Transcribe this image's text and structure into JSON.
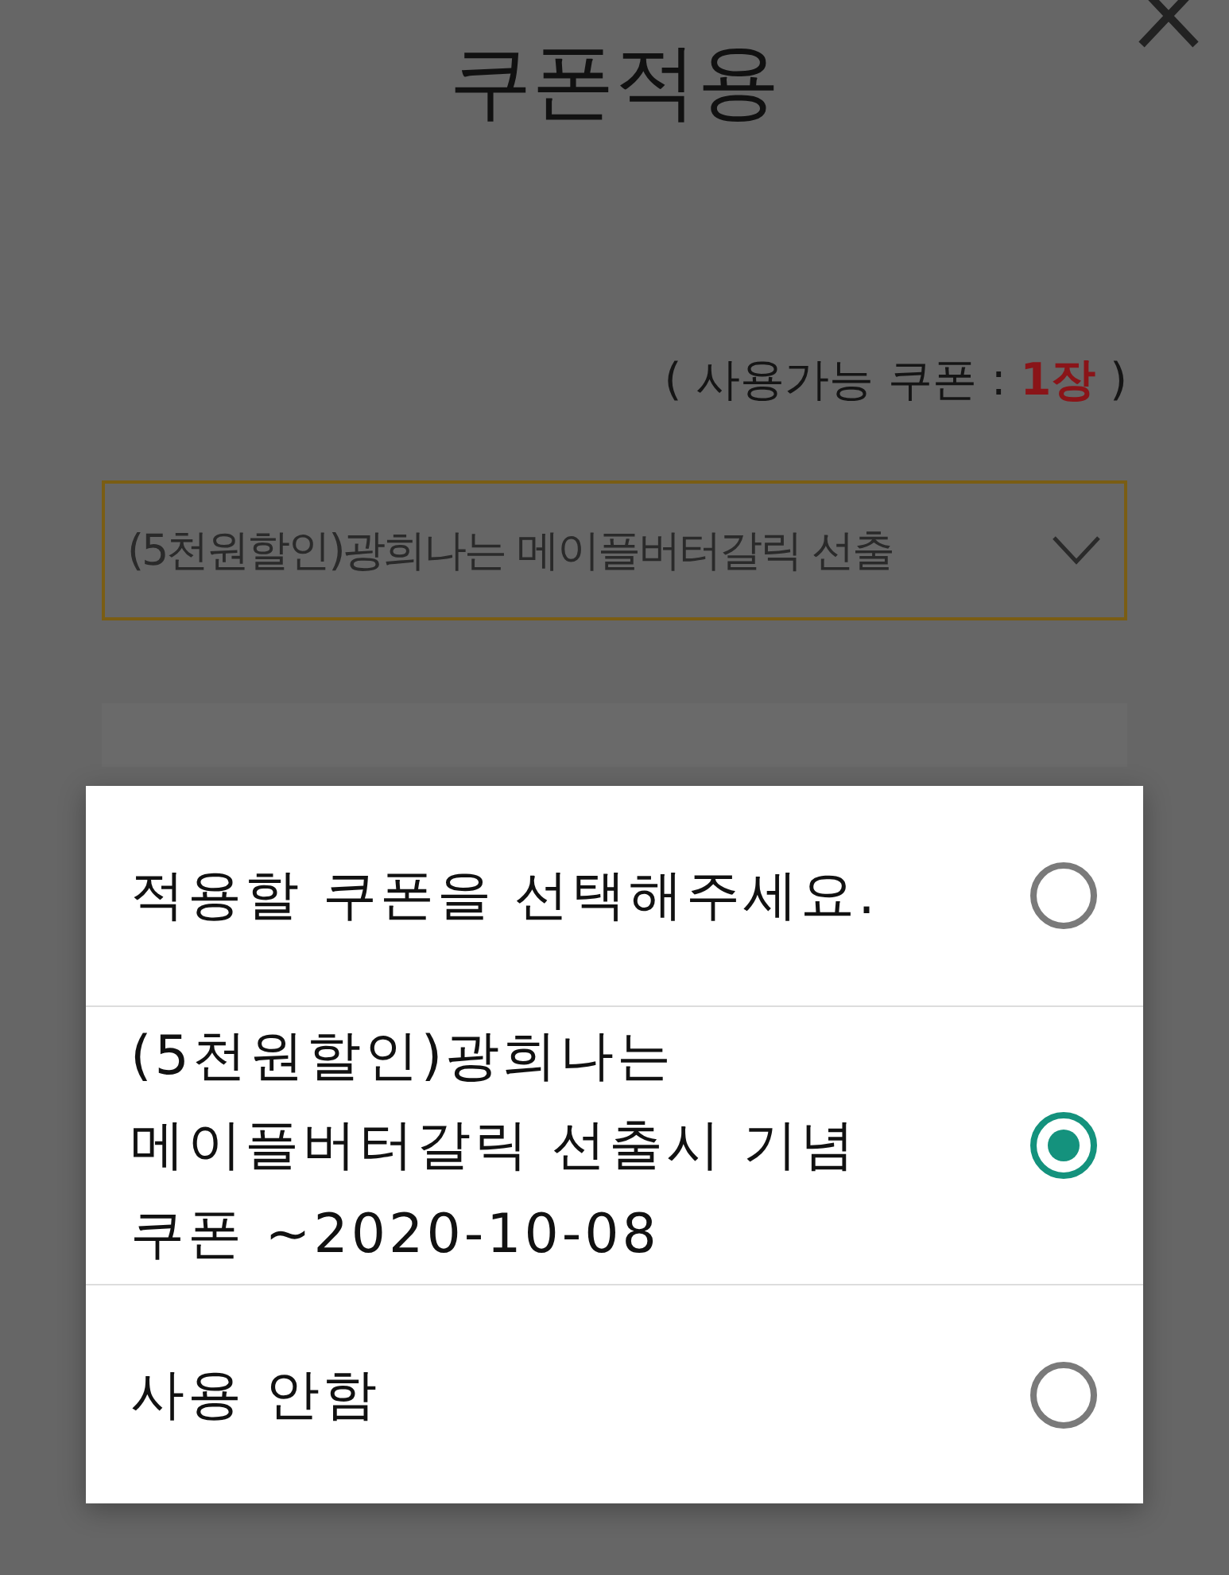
{
  "page": {
    "title": "쿠폰적용",
    "available": {
      "prefix": "( 사용가능 쿠폰 : ",
      "count": "1장",
      "suffix": " )"
    },
    "coupon_select": {
      "value": "(5천원할인)광희나는 메이플버터갈릭 선출"
    }
  },
  "dialog": {
    "options": [
      {
        "label": "적용할 쿠폰을 선택해주세요.",
        "selected": false
      },
      {
        "label": "(5천원할인)광희나는 메이플버터갈릭 선출시 기념 쿠폰 ~2020-10-08",
        "selected": true
      },
      {
        "label": "사용 안함",
        "selected": false
      }
    ]
  }
}
